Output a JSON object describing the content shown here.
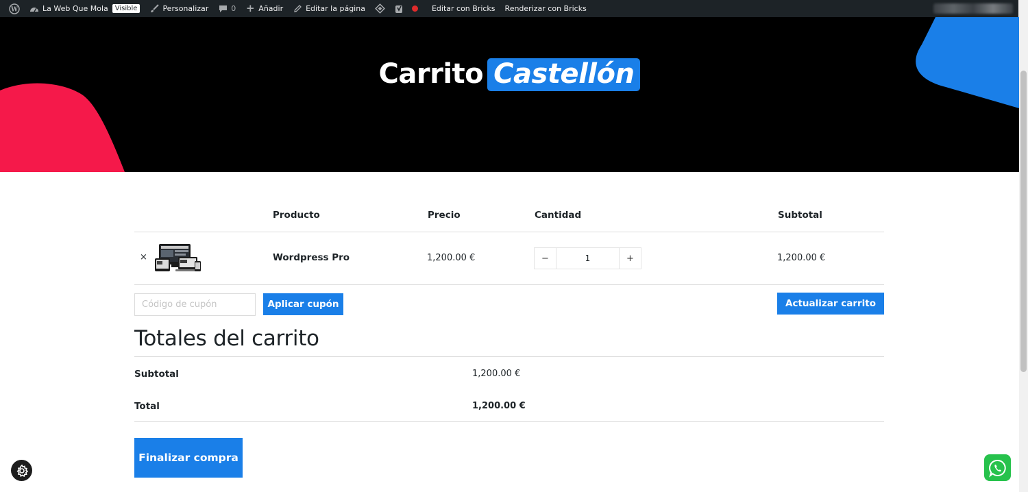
{
  "admin_bar": {
    "site_name": "La Web Que Mola",
    "visibility_badge": "Visible",
    "customize": "Personalizar",
    "comments_count": "0",
    "add_new": "Añadir",
    "edit_page": "Editar la página",
    "edit_bricks": "Editar con Bricks",
    "render_bricks": "Renderizar con Bricks"
  },
  "hero": {
    "title_plain": "Carrito",
    "title_highlight": "Castellón",
    "colors": {
      "background": "#000000",
      "highlight": "#1a7fe8",
      "shape_pink": "#f5194a",
      "shape_blue": "#1a7fe8"
    }
  },
  "cart": {
    "headers": {
      "product": "Producto",
      "price": "Precio",
      "quantity": "Cantidad",
      "subtotal": "Subtotal"
    },
    "items": [
      {
        "remove": "×",
        "thumbnail_icon": "devices-thumbnail",
        "name": "Wordpress Pro",
        "price": "1,200.00 €",
        "quantity": "1",
        "subtotal": "1,200.00 €"
      }
    ],
    "qty_minus": "−",
    "qty_plus": "+",
    "coupon_placeholder": "Código de cupón",
    "apply_coupon": "Aplicar cupón",
    "update_cart": "Actualizar carrito"
  },
  "totals": {
    "title": "Totales del carrito",
    "subtotal_label": "Subtotal",
    "subtotal_value": "1,200.00 €",
    "total_label": "Total",
    "total_value": "1,200.00 €",
    "checkout": "Finalizar compra"
  },
  "widgets": {
    "settings_icon": "gear-icon",
    "whatsapp_icon": "whatsapp-icon",
    "accent": "#1a7fe8",
    "whatsapp_color": "#27c24c"
  }
}
